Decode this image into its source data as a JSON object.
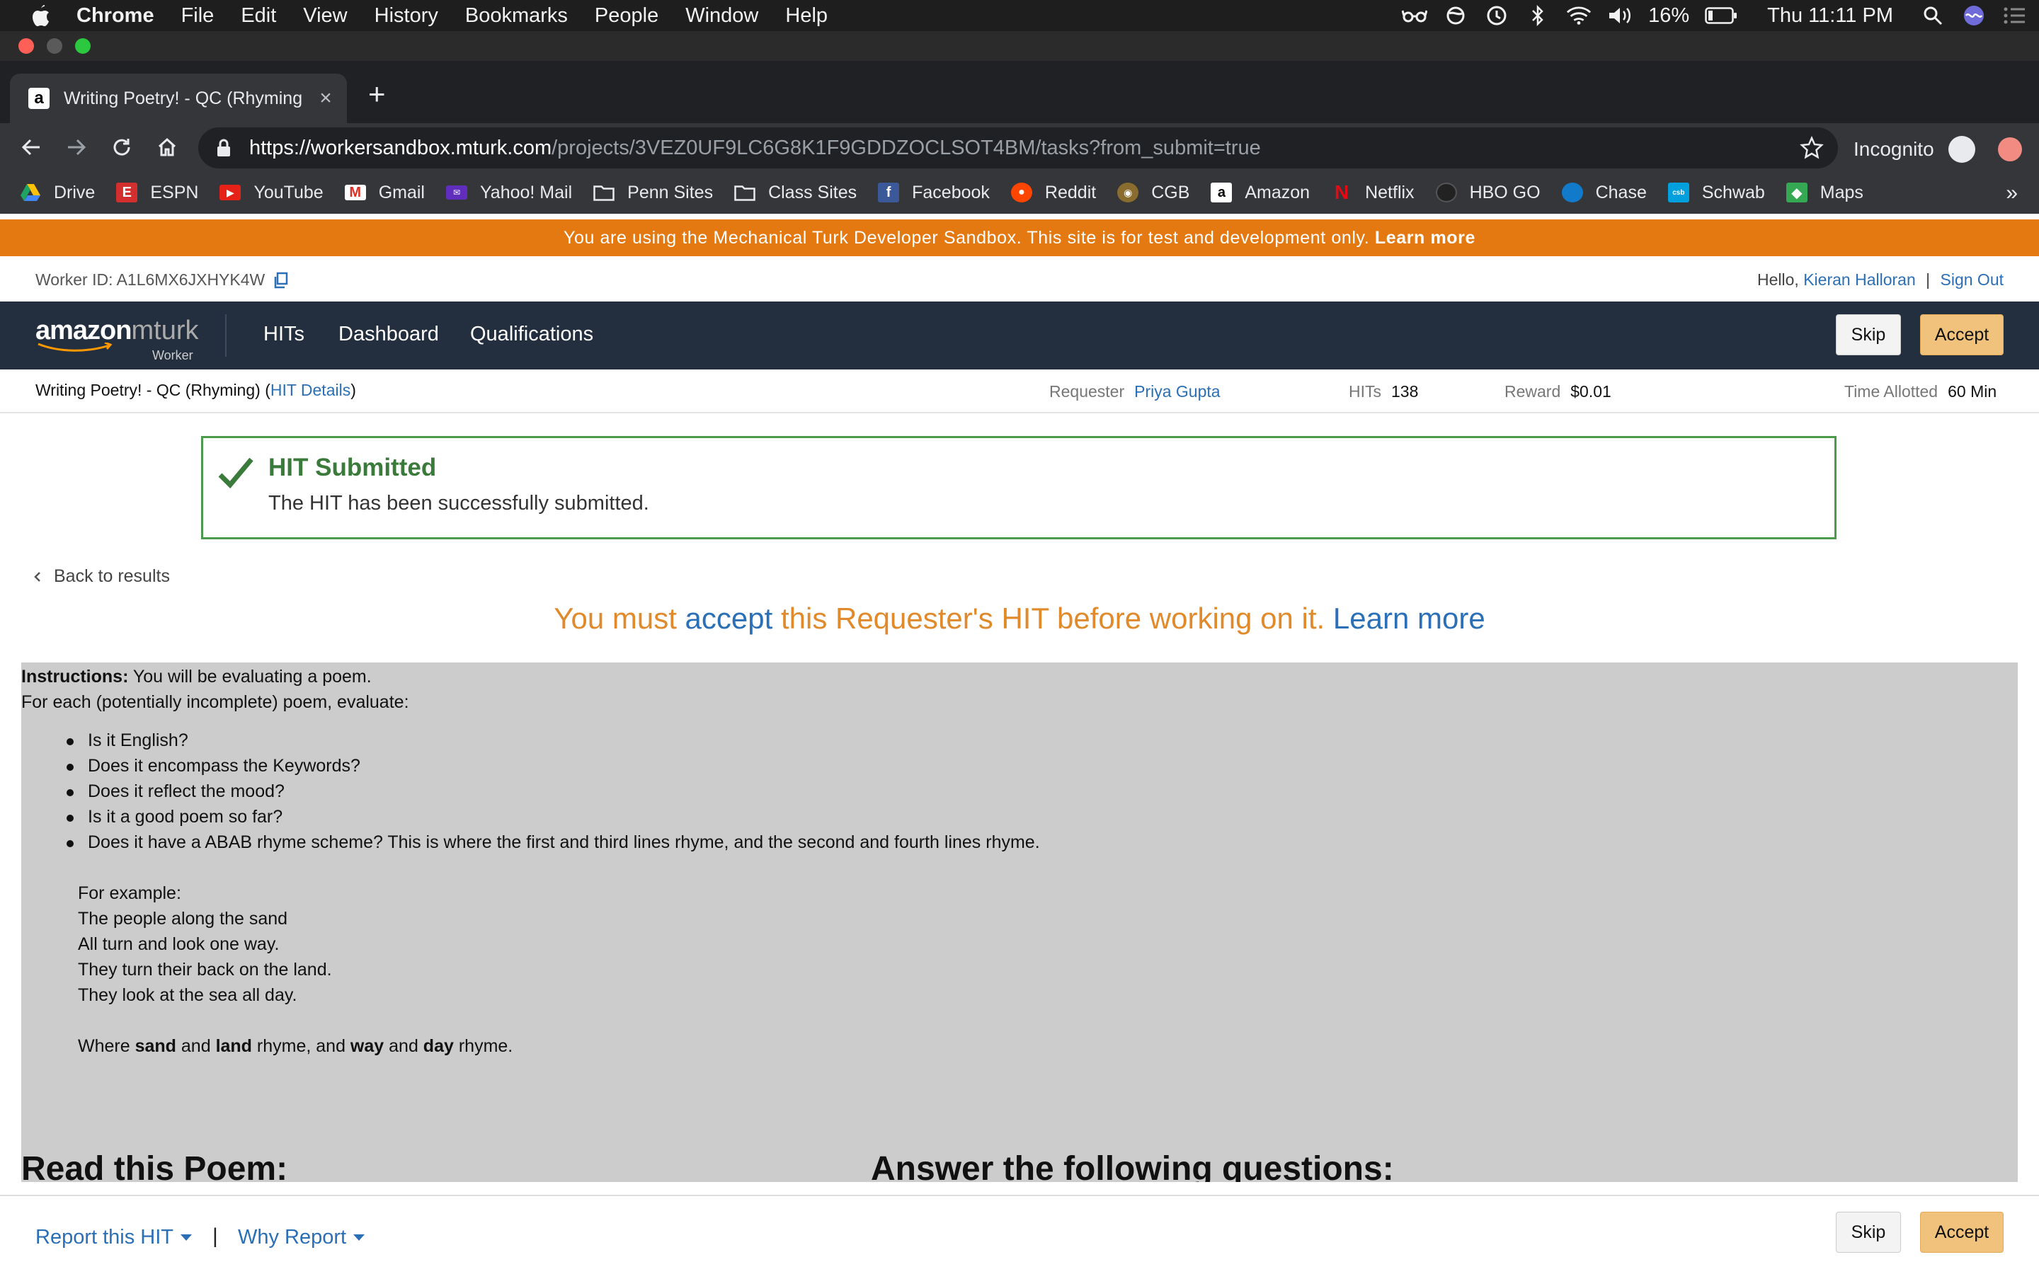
{
  "menubar": {
    "app": "Chrome",
    "items": [
      "File",
      "Edit",
      "View",
      "History",
      "Bookmarks",
      "People",
      "Window",
      "Help"
    ],
    "battery": "16%",
    "clock": "Thu 11:11 PM"
  },
  "browser": {
    "tab_title": "Writing Poetry! - QC (Rhyming",
    "url_host": "https://workersandbox.mturk.com",
    "url_path": "/projects/3VEZ0UF9LC6G8K1F9GDDZOCLSOT4BM/tasks?from_submit=true",
    "incognito_label": "Incognito",
    "bookmarks": [
      {
        "label": "Drive",
        "color": "#1a73e8"
      },
      {
        "label": "ESPN",
        "color": "#d32f2f"
      },
      {
        "label": "YouTube",
        "color": "#e62117"
      },
      {
        "label": "Gmail",
        "color": "#d93025"
      },
      {
        "label": "Yahoo! Mail",
        "color": "#5f2ebc"
      },
      {
        "label": "Penn Sites",
        "color": "folder"
      },
      {
        "label": "Class Sites",
        "color": "folder"
      },
      {
        "label": "Facebook",
        "color": "#3b5998"
      },
      {
        "label": "Reddit",
        "color": "#ff4500"
      },
      {
        "label": "CGB",
        "color": "#8a6d2e"
      },
      {
        "label": "Amazon",
        "color": "#ffffff"
      },
      {
        "label": "Netflix",
        "color": "#e50914"
      },
      {
        "label": "HBO GO",
        "color": "#222222"
      },
      {
        "label": "Chase",
        "color": "#117aca"
      },
      {
        "label": "Schwab",
        "color": "#00a0df"
      },
      {
        "label": "Maps",
        "color": "#34a853"
      }
    ],
    "bookmarks_overflow": "»"
  },
  "banner": {
    "text": "You are using the Mechanical Turk Developer Sandbox. This site is for test and development only.",
    "link": "Learn more"
  },
  "worker": {
    "id_label": "Worker ID: A1L6MX6JXHYK4W",
    "hello": "Hello,",
    "name": "Kieran Halloran",
    "separator": "|",
    "sign_out": "Sign Out"
  },
  "nav": {
    "logo_main": "amazon",
    "logo_mturk": "mturk",
    "logo_sub": "Worker",
    "links": [
      "HITs",
      "Dashboard",
      "Qualifications"
    ],
    "skip": "Skip",
    "accept": "Accept"
  },
  "hit": {
    "title": "Writing Poetry! - QC (Rhyming)",
    "details_open": "(",
    "details_link": "HIT Details",
    "details_close": ")",
    "requester_label": "Requester",
    "requester": "Priya Gupta",
    "hits_label": "HITs",
    "hits": "138",
    "reward_label": "Reward",
    "reward": "$0.01",
    "time_label": "Time Allotted",
    "time": "60 Min"
  },
  "alert": {
    "title": "HIT Submitted",
    "message": "The HIT has been successfully submitted."
  },
  "back": "Back to results",
  "must_accept": {
    "pre": "You must ",
    "accept": "accept",
    "mid": " this Requester's HIT before working on it. ",
    "learn": "Learn more"
  },
  "instructions": {
    "label": "Instructions:",
    "intro": " You will be evaluating a poem.",
    "each": "For each (potentially incomplete) poem, evaluate:",
    "bullets": [
      "Is it English?",
      "Does it encompass the Keywords?",
      "Does it reflect the mood?",
      "Is it a good poem so far?",
      "Does it have a ABAB rhyme scheme? This is where the first and third lines rhyme, and the second and fourth lines rhyme."
    ],
    "example_label": "For example:",
    "poem": [
      "The people along the sand",
      "All turn and look one way.",
      "They turn their back on the land.",
      "They look at the sea all day."
    ],
    "where": {
      "w1": "Where ",
      "b1": "sand",
      "w2": " and ",
      "b2": "land",
      "w3": " rhyme, and ",
      "b3": "way",
      "w4": " and ",
      "b4": "day",
      "w5": " rhyme."
    },
    "read_heading": "Read this Poem:",
    "answer_heading": "Answer the following questions:"
  },
  "footer": {
    "report": "Report this HIT",
    "separator": "|",
    "why": "Why Report",
    "skip": "Skip",
    "accept": "Accept"
  }
}
